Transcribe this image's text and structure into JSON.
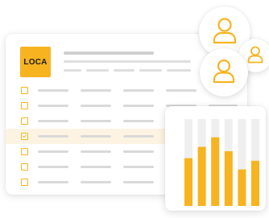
{
  "logo": {
    "text": "LOCA"
  },
  "table": {
    "rows": [
      {
        "checked": false
      },
      {
        "checked": false
      },
      {
        "checked": false
      },
      {
        "checked": true
      },
      {
        "checked": false
      },
      {
        "checked": false
      },
      {
        "checked": false
      }
    ]
  },
  "icons": {
    "checkbox": "checkbox-icon",
    "user": "user-icon"
  },
  "colors": {
    "accent": "#f7b320",
    "placeholder": "#d9d9d9",
    "selected_row": "#fdf3e2",
    "bar_track": "#efefef"
  },
  "chart_data": {
    "type": "bar",
    "values": [
      0.55,
      0.68,
      0.79,
      0.63,
      0.42,
      0.52
    ],
    "ylim": [
      0,
      1
    ]
  }
}
